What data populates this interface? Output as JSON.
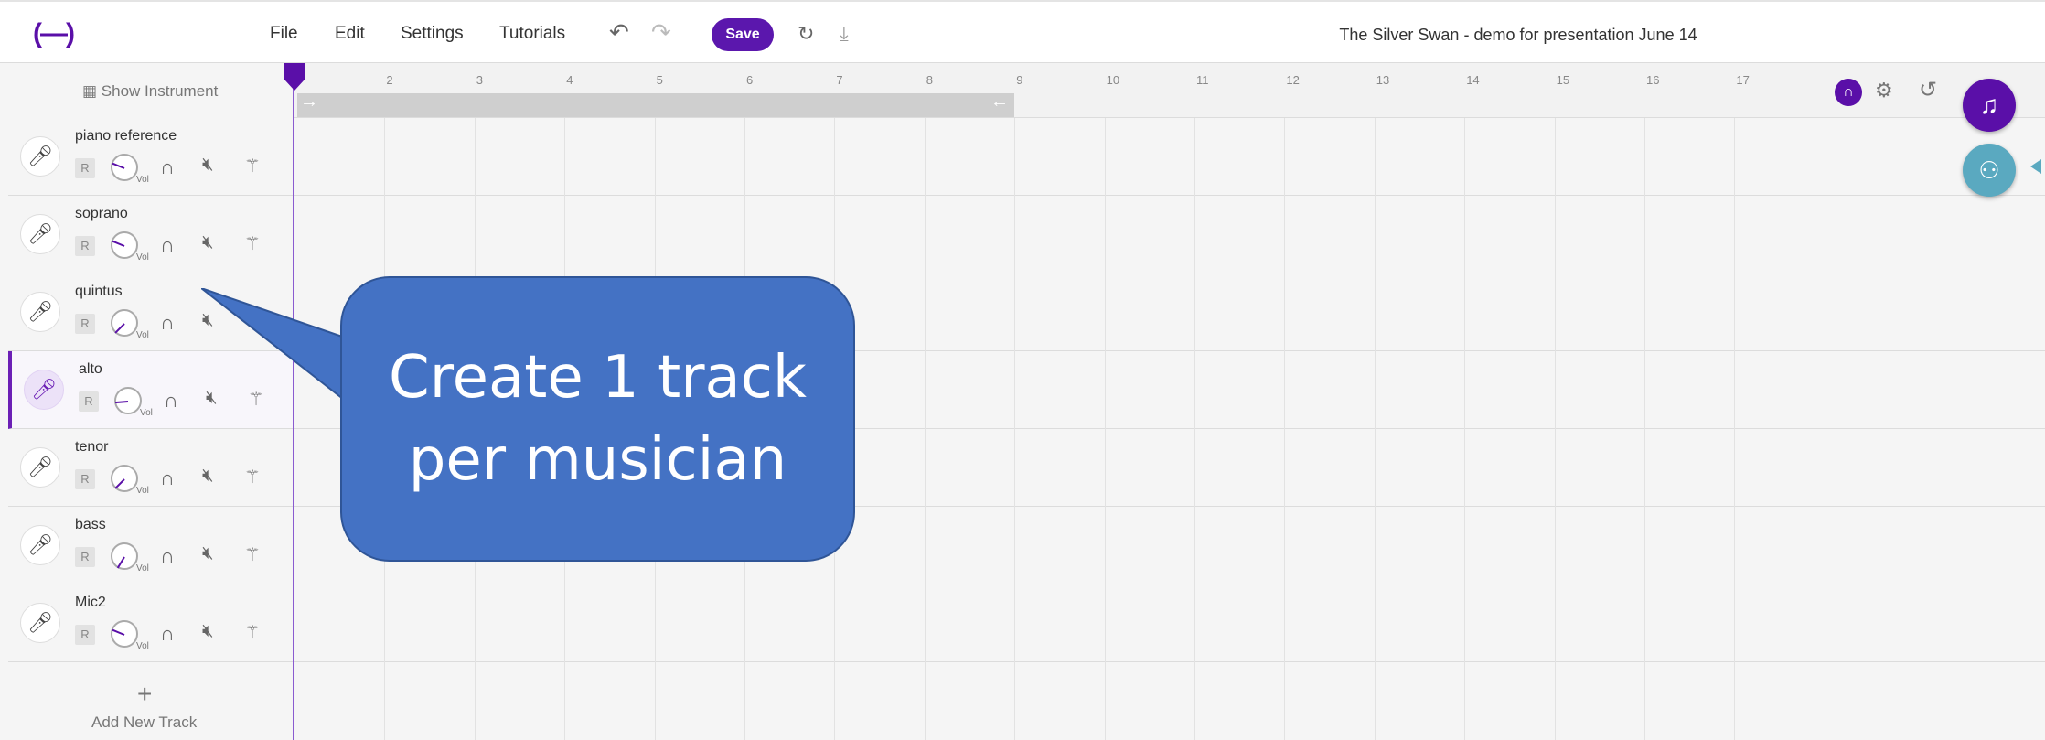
{
  "app": {
    "logo": "(—)",
    "title": "The Silver Swan - demo for presentation June 14"
  },
  "menu": {
    "file": "File",
    "edit": "Edit",
    "settings": "Settings",
    "tutorials": "Tutorials"
  },
  "toolbar": {
    "save": "Save"
  },
  "left": {
    "show_instrument": "Show Instrument",
    "add_track": "Add New Track"
  },
  "tracks": [
    {
      "name": "piano reference",
      "r": "R",
      "vol_label": "Vol",
      "volume": 0.75,
      "selected": false
    },
    {
      "name": "soprano",
      "r": "R",
      "vol_label": "Vol",
      "volume": 0.75,
      "selected": false
    },
    {
      "name": "quintus",
      "r": "R",
      "vol_label": "Vol",
      "volume": 0.5,
      "selected": false
    },
    {
      "name": "alto",
      "r": "R",
      "vol_label": "Vol",
      "volume": 0.65,
      "selected": true
    },
    {
      "name": "tenor",
      "r": "R",
      "vol_label": "Vol",
      "volume": 0.5,
      "selected": false
    },
    {
      "name": "bass",
      "r": "R",
      "vol_label": "Vol",
      "volume": 0.45,
      "selected": false
    },
    {
      "name": "Mic2",
      "r": "R",
      "vol_label": "Vol",
      "volume": 0.75,
      "selected": false
    }
  ],
  "ruler": {
    "labels": [
      "2",
      "3",
      "4",
      "5",
      "6",
      "7",
      "8",
      "9",
      "10",
      "11",
      "12",
      "13",
      "14",
      "15",
      "16",
      "17"
    ]
  },
  "callout": {
    "line1": "Create 1 track",
    "line2": "per musician"
  },
  "colors": {
    "accent": "#5a0fa8",
    "callout": "#4472c4",
    "collab": "#5aa9c0"
  }
}
